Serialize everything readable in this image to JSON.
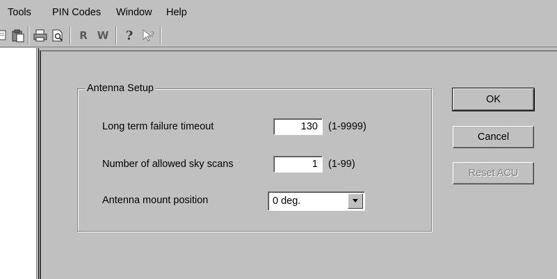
{
  "menu": {
    "items": [
      {
        "label": "Tools"
      },
      {
        "label": "PIN Codes"
      },
      {
        "label": "Window"
      },
      {
        "label": "Help"
      }
    ]
  },
  "toolbar": {
    "icons": [
      "copy-icon",
      "paste-icon",
      "print-icon",
      "print-preview-icon",
      "read-icon",
      "write-icon",
      "help-icon",
      "context-help-icon"
    ],
    "read_label": "R",
    "write_label": "W",
    "help_label": "?"
  },
  "dialog": {
    "group_title": "Antenna Setup",
    "fields": [
      {
        "label": "Long term failure timeout",
        "value": "130",
        "range": "(1-9999)"
      },
      {
        "label": "Number of allowed sky scans",
        "value": "1",
        "range": "(1-99)"
      },
      {
        "label": "Antenna mount position",
        "value": "0 deg."
      }
    ],
    "buttons": {
      "ok": "OK",
      "cancel": "Cancel",
      "reset": "Reset ACU"
    }
  }
}
